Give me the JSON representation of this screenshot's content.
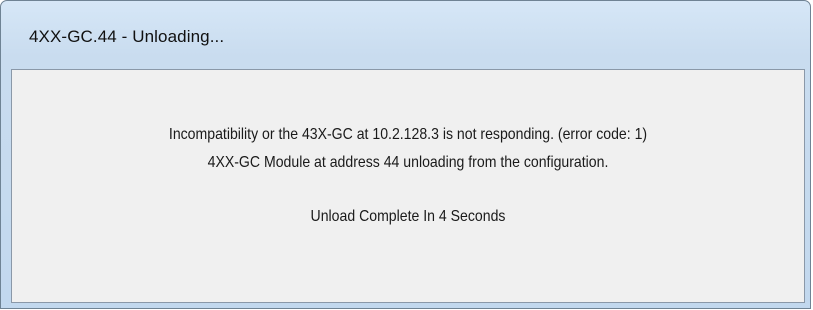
{
  "window": {
    "title": "4XX-GC.44 - Unloading..."
  },
  "message": {
    "line1": "Incompatibility or the 43X-GC at 10.2.128.3 is not responding. (error code: 1)",
    "line2": "4XX-GC Module at address 44 unloading from the configuration.",
    "countdown": "Unload Complete In 4 Seconds"
  }
}
